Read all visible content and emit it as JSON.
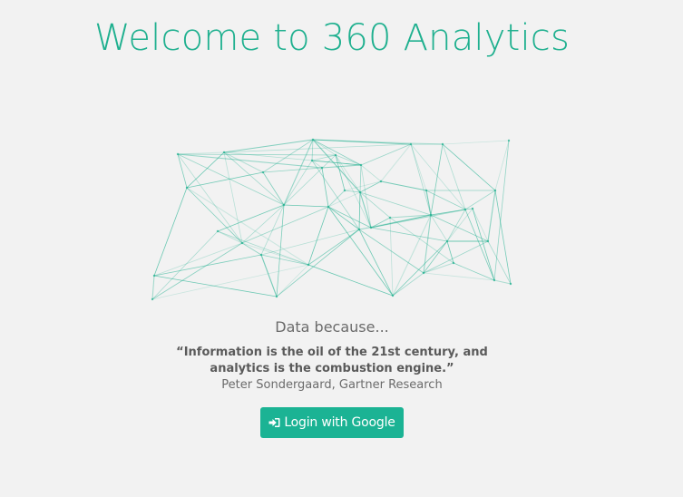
{
  "page": {
    "title": "Welcome to 360 Analytics",
    "subtitle": "Data because...",
    "quote": "“Information is the oil of the 21st century, and analytics is the combustion engine.”",
    "attribution": "Peter Sondergaard, Gartner Research"
  },
  "login": {
    "label": "Login with Google",
    "icon": "sign-in-icon"
  },
  "colors": {
    "accent": "#1bb394",
    "title": "#1fb08f",
    "network_line": "#1fb08f",
    "background": "#f2f2f2"
  }
}
